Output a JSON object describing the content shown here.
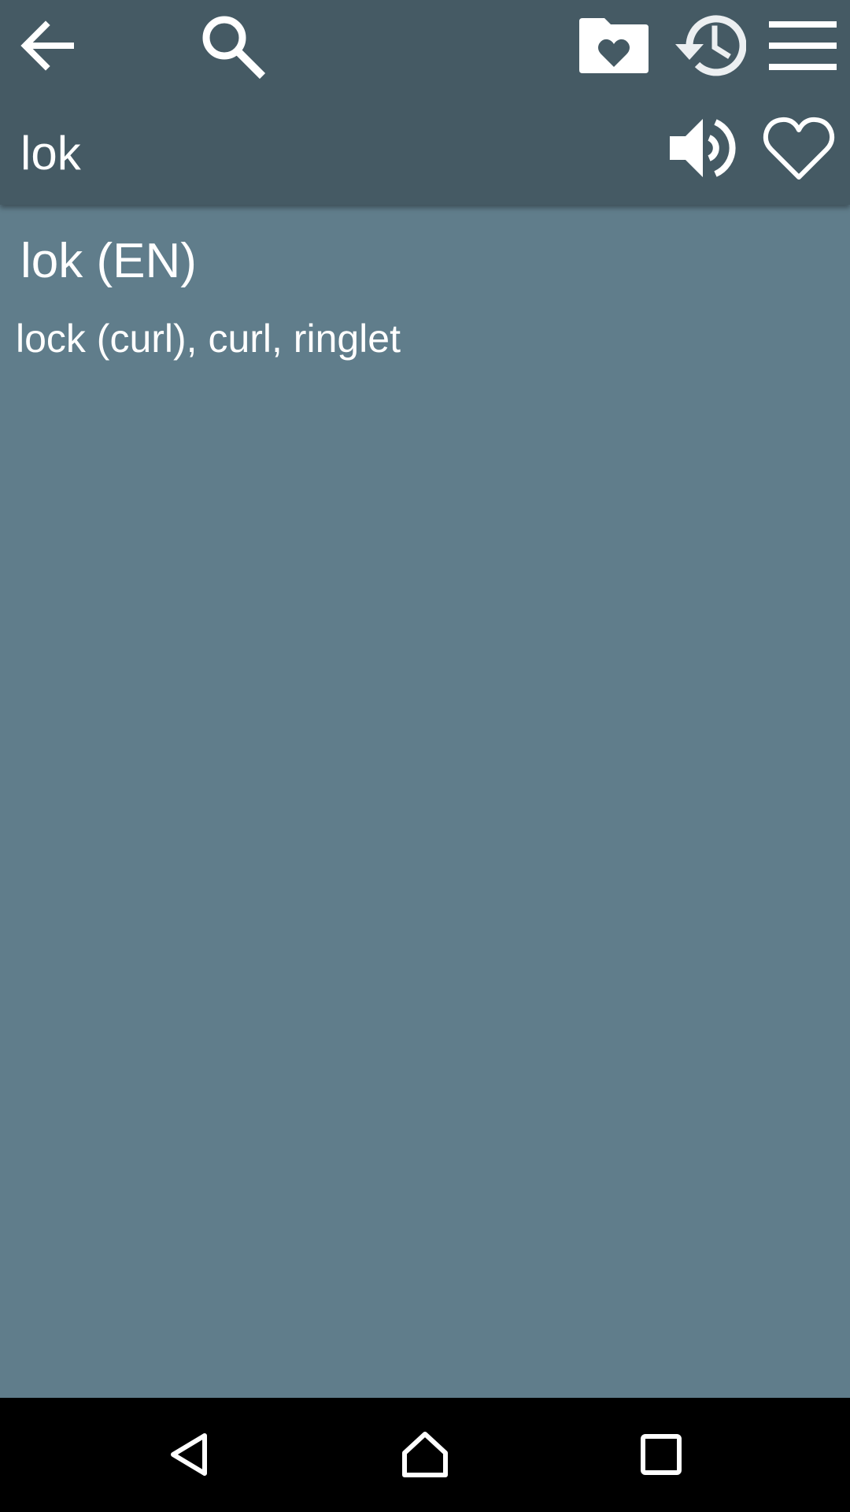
{
  "header": {
    "query": "lok",
    "icons": {
      "back": "arrow-back-icon",
      "search": "search-icon",
      "favorites_folder": "folder-heart-icon",
      "history": "history-icon",
      "menu": "hamburger-menu-icon",
      "speak": "volume-icon",
      "favorite": "heart-outline-icon"
    }
  },
  "entry": {
    "title": "lok (EN)",
    "translation": "lock (curl), curl, ringlet"
  },
  "navbar": {
    "icons": {
      "back": "nav-back-triangle-icon",
      "home": "nav-home-icon",
      "recents": "nav-recents-square-icon"
    }
  },
  "colors": {
    "header_bg": "#455a64",
    "content_bg": "#607d8b",
    "navbar_bg": "#000000",
    "text": "#ffffff"
  }
}
